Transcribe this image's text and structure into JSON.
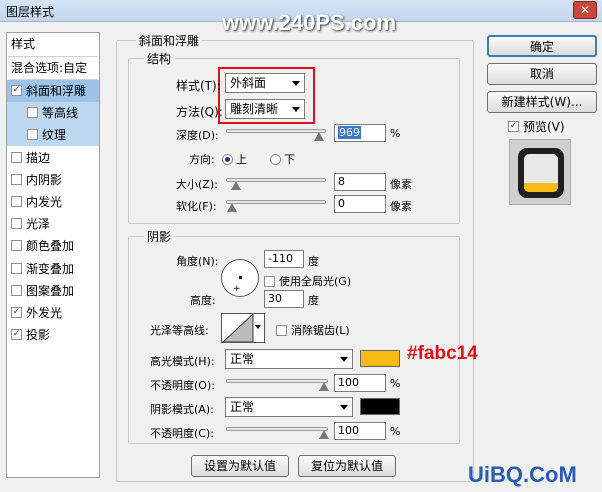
{
  "window": {
    "title": "图层样式",
    "watermark": "www.240PS.com",
    "close_label": "✕"
  },
  "left_panel": {
    "header": "样式",
    "blend_options": "混合选项:自定",
    "items": [
      {
        "label": "斜面和浮雕",
        "checked": true
      },
      {
        "label": "等高线",
        "checked": false
      },
      {
        "label": "纹理",
        "checked": false
      },
      {
        "label": "描边",
        "checked": false
      },
      {
        "label": "内阴影",
        "checked": false
      },
      {
        "label": "内发光",
        "checked": false
      },
      {
        "label": "光泽",
        "checked": false
      },
      {
        "label": "颜色叠加",
        "checked": false
      },
      {
        "label": "渐变叠加",
        "checked": false
      },
      {
        "label": "图案叠加",
        "checked": false
      },
      {
        "label": "外发光",
        "checked": true
      },
      {
        "label": "投影",
        "checked": true
      }
    ]
  },
  "bevel": {
    "section_title": "斜面和浮雕",
    "structure_title": "结构",
    "style_label": "样式(T):",
    "style_value": "外斜面",
    "technique_label": "方法(Q):",
    "technique_value": "雕刻清晰",
    "depth_label": "深度(D):",
    "depth_value": "969",
    "depth_unit": "%",
    "depth_pct": 0.97,
    "direction_label": "方向:",
    "dir_up": "上",
    "dir_down": "下",
    "size_label": "大小(Z):",
    "size_value": "8",
    "size_unit": "像素",
    "size_pct": 0.04,
    "soften_label": "软化(F):",
    "soften_value": "0",
    "soften_unit": "像素",
    "soften_pct": 0.0
  },
  "shading": {
    "title": "阴影",
    "angle_label": "角度(N):",
    "angle_value": "-110",
    "angle_unit": "度",
    "global_light_label": "使用全局光(G)",
    "altitude_label": "高度:",
    "altitude_value": "30",
    "altitude_unit": "度",
    "gloss_label": "光泽等高线:",
    "antialias_label": "消除锯齿(L)",
    "highlight_label": "高光模式(H):",
    "highlight_mode": "正常",
    "highlight_color": "#fabc14",
    "highlight_annotation": "#fabc14",
    "hl_opacity_label": "不透明度(O):",
    "hl_opacity_value": "100",
    "hl_opacity_unit": "%",
    "hl_opacity_pct": 1.0,
    "shadow_label": "阴影模式(A):",
    "shadow_mode": "正常",
    "shadow_color": "#000000",
    "sh_opacity_label": "不透明度(C):",
    "sh_opacity_value": "100",
    "sh_opacity_unit": "%",
    "sh_opacity_pct": 1.0
  },
  "defaults": {
    "make_default": "设置为默认值",
    "reset_default": "复位为默认值"
  },
  "right": {
    "ok": "确定",
    "cancel": "取消",
    "new_style": "新建样式(W)...",
    "preview_label": "预览(V)",
    "preview_checked": true
  },
  "footer_watermark": "UiBQ.CoM"
}
